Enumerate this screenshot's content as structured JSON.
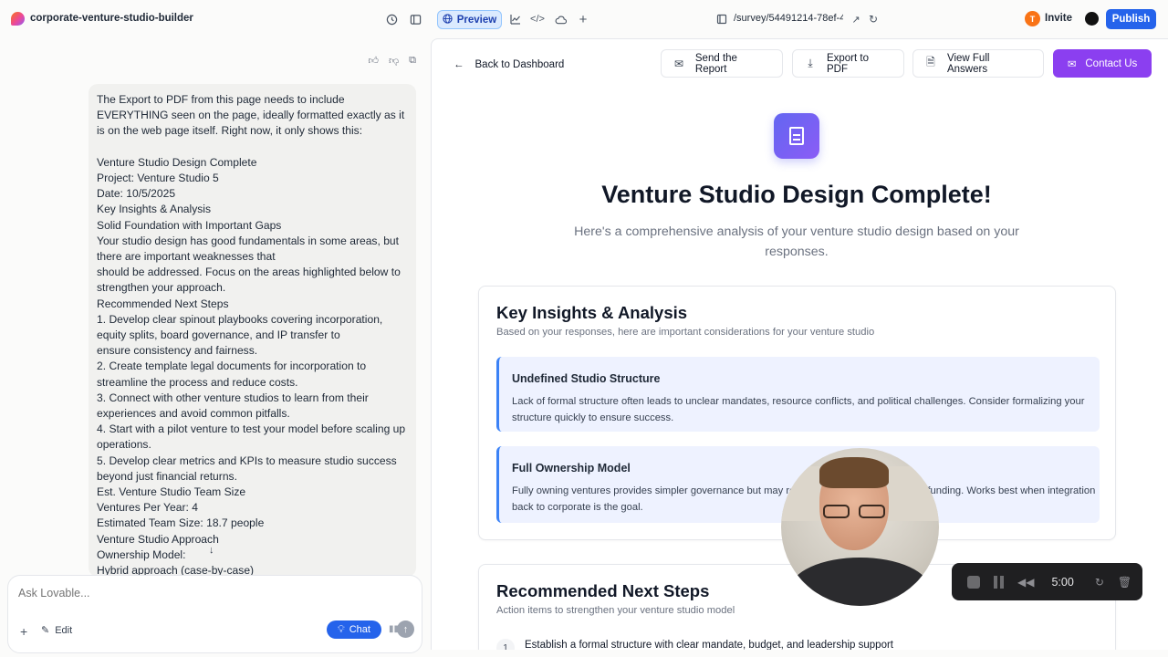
{
  "topbar": {
    "project_name": "corporate-venture-studio-builder",
    "preview_label": "Preview",
    "url": "/survey/54491214-78ef-4",
    "invite_initial": "T",
    "invite_label": "Invite",
    "publish_label": "Publish"
  },
  "chat": {
    "message": "The Export to PDF from this page needs to include EVERYTHING seen on the page, ideally formatted exactly as it is on the web page itself. Right now, it only shows this:\n\nVenture Studio Design Complete\nProject: Venture Studio 5\nDate: 10/5/2025\nKey Insights & Analysis\nSolid Foundation with Important Gaps\nYour studio design has good fundamentals in some areas, but there are important weaknesses that\nshould be addressed. Focus on the areas highlighted below to strengthen your approach.\nRecommended Next Steps\n1. Develop clear spinout playbooks covering incorporation, equity splits, board governance, and IP transfer to\nensure consistency and fairness.\n2. Create template legal documents for incorporation to streamline the process and reduce costs.\n3. Connect with other venture studios to learn from their experiences and avoid common pitfalls.\n4. Start with a pilot venture to test your model before scaling up operations.\n5. Develop clear metrics and KPIs to measure studio success beyond just financial returns.\nEst. Venture Studio Team Size\nVentures Per Year: 4\nEstimated Team Size: 18.7 people\nVenture Studio Approach\nOwnership Model:\nHybrid approach (case-by-case)",
    "composer_placeholder": "Ask Lovable...",
    "edit_label": "Edit",
    "chat_label": "Chat"
  },
  "preview": {
    "back_label": "Back to Dashboard",
    "send_report_label": "Send the Report",
    "export_pdf_label": "Export to PDF",
    "view_answers_label": "View Full Answers",
    "contact_label": "Contact Us",
    "hero_title": "Venture Studio Design Complete!",
    "hero_subtitle": "Here's a comprehensive analysis of your venture studio design based on your responses.",
    "insights": {
      "title": "Key Insights & Analysis",
      "subtitle": "Based on your responses, here are important considerations for your venture studio",
      "items": [
        {
          "title": "Undefined Studio Structure",
          "text": "Lack of formal structure often leads to unclear mandates, resource conflicts, and political challenges. Consider formalizing your structure quickly to ensure success."
        },
        {
          "title": "Full Ownership Model",
          "text": "Fully owning ventures provides simpler governance but may re... you're fully responsible for funding. Works best when integration back to corporate is the goal."
        }
      ]
    },
    "next_steps": {
      "title": "Recommended Next Steps",
      "subtitle": "Action items to strengthen your venture studio model",
      "items": [
        {
          "number": "1",
          "text": "Establish a formal structure with clear mandate, budget, and leadership support"
        }
      ]
    }
  },
  "recorder": {
    "time": "5:00"
  },
  "colors": {
    "brand_blue": "#2563eb",
    "accent_purple": "#8b3ff0",
    "insight_bg": "#eef2ff",
    "insight_border": "#3b82f6"
  }
}
